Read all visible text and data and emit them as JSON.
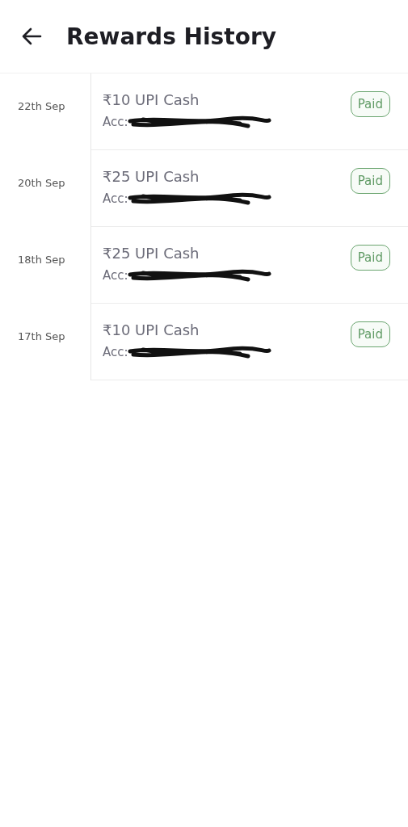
{
  "header": {
    "title": "Rewards History"
  },
  "rewards": [
    {
      "date": "22th Sep",
      "title": "₹10 UPI Cash",
      "account_label": "Acc:",
      "status": "Paid"
    },
    {
      "date": "20th Sep",
      "title": "₹25 UPI Cash",
      "account_label": "Acc:",
      "status": "Paid"
    },
    {
      "date": "18th Sep",
      "title": "₹25 UPI Cash",
      "account_label": "Acc:",
      "status": "Paid"
    },
    {
      "date": "17th Sep",
      "title": "₹10 UPI Cash",
      "account_label": "Acc:",
      "status": "Paid"
    }
  ]
}
